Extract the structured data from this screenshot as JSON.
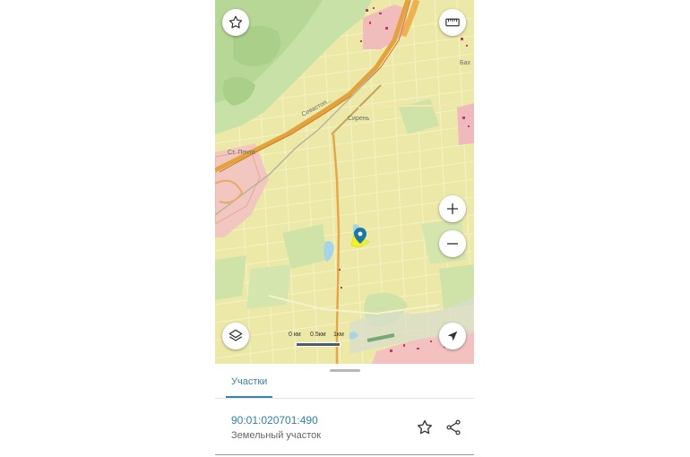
{
  "map": {
    "labels": {
      "sevastyan": "Севастоп...",
      "siren": "Сирень",
      "st_pochta": "Ст. Почта",
      "bakh": "Бах"
    },
    "scale": {
      "t0": "0 км",
      "t1": "0.5км",
      "t2": "1км"
    },
    "colors": {
      "base": "#ece9a8",
      "park": "#cde4a8",
      "forest": "#b9d99b",
      "road_main": "#e3a23b",
      "urban": "#f2c7c0",
      "marker": "#1d77a8"
    }
  },
  "controls": {
    "favorite_icon": "star-outline-icon",
    "ruler_icon": "ruler-icon",
    "zoom_in_icon": "plus-icon",
    "zoom_out_icon": "minus-icon",
    "layers_icon": "layers-icon",
    "locate_icon": "navigation-arrow-icon"
  },
  "sheet": {
    "tab_label": "Участки",
    "result": {
      "cadastral_number": "90:01:020701:490",
      "object_type": "Земельный участок"
    }
  }
}
